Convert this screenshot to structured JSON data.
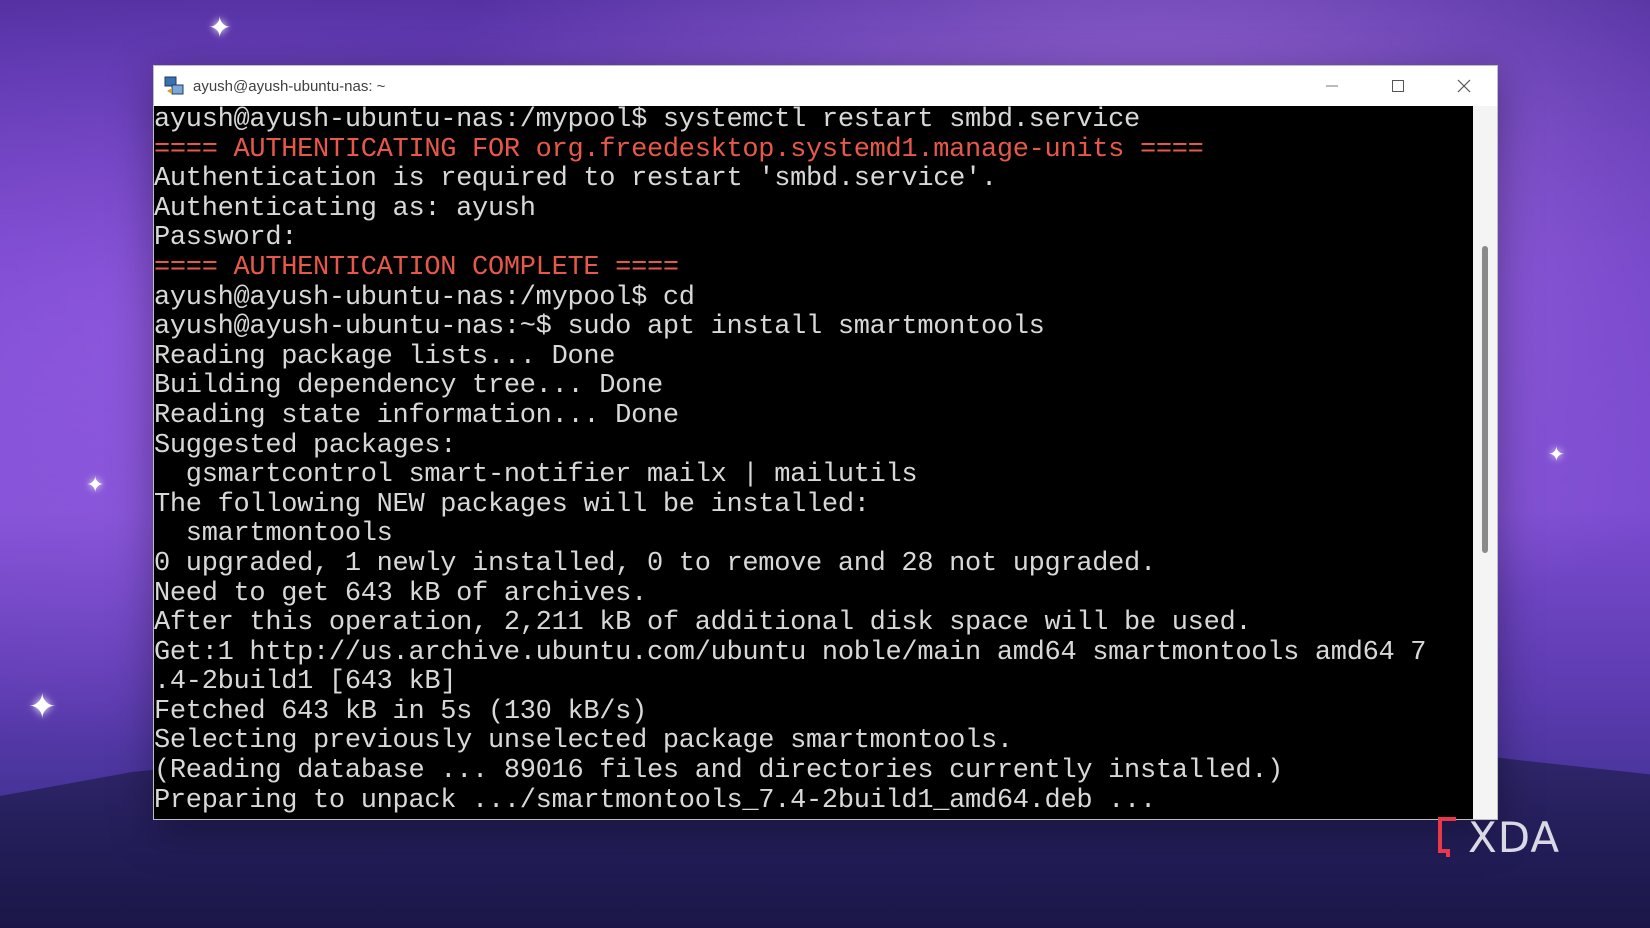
{
  "window": {
    "title": "ayush@ayush-ubuntu-nas: ~",
    "controls": {
      "minimize_icon": "minimize-icon",
      "maximize_icon": "maximize-icon",
      "close_icon": "close-icon"
    }
  },
  "terminal": {
    "lines": [
      {
        "text": "ayush@ayush-ubuntu-nas:/mypool$ systemctl restart smbd.service",
        "color": "#d8d8d8"
      },
      {
        "text": "==== AUTHENTICATING FOR org.freedesktop.systemd1.manage-units ====",
        "color": "#e8584a"
      },
      {
        "text": "Authentication is required to restart 'smbd.service'.",
        "color": "#d8d8d8"
      },
      {
        "text": "Authenticating as: ayush",
        "color": "#d8d8d8"
      },
      {
        "text": "Password:",
        "color": "#d8d8d8"
      },
      {
        "text": "==== AUTHENTICATION COMPLETE ====",
        "color": "#e8584a"
      },
      {
        "text": "ayush@ayush-ubuntu-nas:/mypool$ cd",
        "color": "#d8d8d8"
      },
      {
        "text": "ayush@ayush-ubuntu-nas:~$ sudo apt install smartmontools",
        "color": "#d8d8d8"
      },
      {
        "text": "Reading package lists... Done",
        "color": "#d8d8d8"
      },
      {
        "text": "Building dependency tree... Done",
        "color": "#d8d8d8"
      },
      {
        "text": "Reading state information... Done",
        "color": "#d8d8d8"
      },
      {
        "text": "Suggested packages:",
        "color": "#d8d8d8"
      },
      {
        "text": "  gsmartcontrol smart-notifier mailx | mailutils",
        "color": "#d8d8d8"
      },
      {
        "text": "The following NEW packages will be installed:",
        "color": "#d8d8d8"
      },
      {
        "text": "  smartmontools",
        "color": "#d8d8d8"
      },
      {
        "text": "0 upgraded, 1 newly installed, 0 to remove and 28 not upgraded.",
        "color": "#d8d8d8"
      },
      {
        "text": "Need to get 643 kB of archives.",
        "color": "#d8d8d8"
      },
      {
        "text": "After this operation, 2,211 kB of additional disk space will be used.",
        "color": "#d8d8d8"
      },
      {
        "text": "Get:1 http://us.archive.ubuntu.com/ubuntu noble/main amd64 smartmontools amd64 7",
        "color": "#d8d8d8"
      },
      {
        "text": ".4-2build1 [643 kB]",
        "color": "#d8d8d8"
      },
      {
        "text": "Fetched 643 kB in 5s (130 kB/s)",
        "color": "#d8d8d8"
      },
      {
        "text": "Selecting previously unselected package smartmontools.",
        "color": "#d8d8d8"
      },
      {
        "text": "(Reading database ... 89016 files and directories currently installed.)",
        "color": "#d8d8d8"
      },
      {
        "text": "Preparing to unpack .../smartmontools_7.4-2build1_amd64.deb ...",
        "color": "#d8d8d8"
      }
    ]
  },
  "watermark": {
    "text": "XDA"
  }
}
